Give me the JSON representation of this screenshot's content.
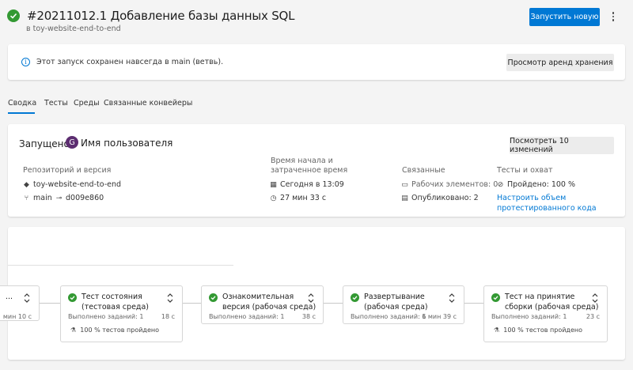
{
  "header": {
    "title": "#20211012.1 Добавление базы данных SQL",
    "repo": "в toy-website-end-to-end",
    "run_button": "Запустить новую"
  },
  "banner": {
    "text": "Этот запуск сохранен навсегда в main (ветвь).",
    "retention_button": "Просмотр аренд хранения"
  },
  "tabs": [
    "Сводка",
    "Тесты",
    "Среды",
    "Связанные конвейеры"
  ],
  "summary": {
    "started_label": "Запущено",
    "avatar_letter": "G",
    "username": "Имя пользователя",
    "changes_button": "Посмотреть 10 изменений",
    "repo_section": {
      "label": "Репозиторий и версия",
      "repo": "toy-website-end-to-end",
      "branch": "main",
      "commit": "d009e860"
    },
    "time_section": {
      "label_line1": "Время начала и",
      "label_line2": "затраченное время",
      "start": "Сегодня в 13:09",
      "duration": "27 мин 33 с"
    },
    "related_section": {
      "label": "Связанные",
      "work_items": "Рабочих элементов: 0",
      "published": "Опубликовано: 2"
    },
    "tests_section": {
      "label": "Тесты и охват",
      "passed": "Пройдено: 100 %",
      "link_line1": "Настроить объем",
      "link_line2": "протестированного кода"
    }
  },
  "stages": [
    {
      "name_line1": "...",
      "name_line2": "",
      "jobs": "",
      "time": "мин 10 с",
      "tests": ""
    },
    {
      "name_line1": "Тест состояния",
      "name_line2": "(тестовая среда)",
      "jobs": "Выполнено заданий: 1",
      "time": "18 с",
      "tests": "100 % тестов пройдено"
    },
    {
      "name_line1": "Ознакомительная",
      "name_line2": "версия (рабочая среда)",
      "jobs": "Выполнено заданий: 1",
      "time": "38 с",
      "tests": ""
    },
    {
      "name_line1": "Развертывание",
      "name_line2": "(рабочая среда)",
      "jobs": "Выполнено заданий: 1",
      "time": "6 мин 39 с",
      "tests": ""
    },
    {
      "name_line1": "Тест на принятие",
      "name_line2": "сборки (рабочая среда)",
      "jobs": "Выполнено заданий: 1",
      "time": "23 с",
      "tests": "100 % тестов пройдено"
    }
  ],
  "colors": {
    "accent": "#0078d4",
    "success": "#339933",
    "avatar": "#5c2d70"
  }
}
